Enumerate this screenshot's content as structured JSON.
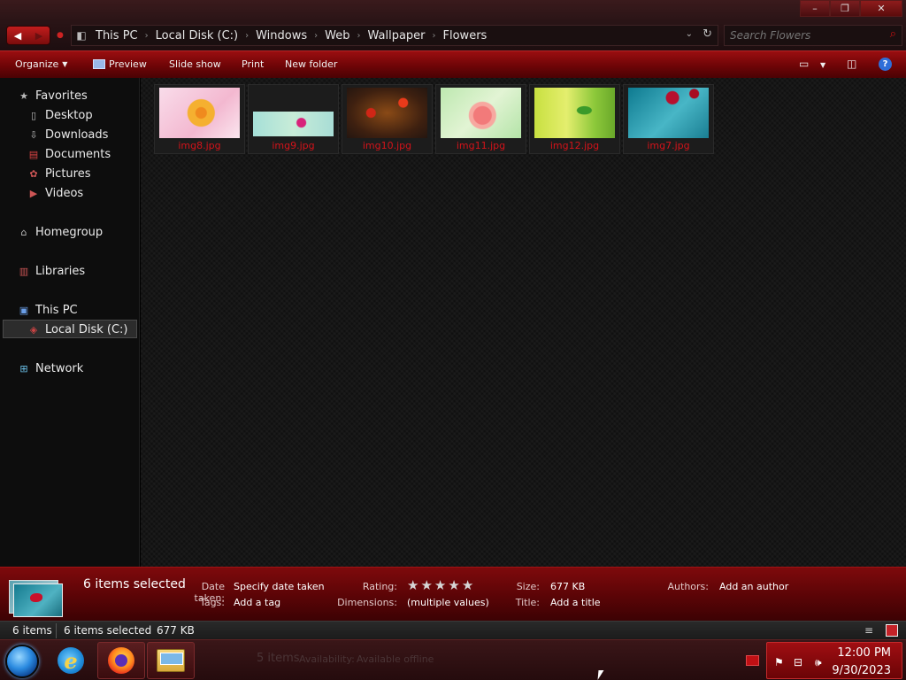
{
  "window": {
    "caption_minimize": "–",
    "caption_maximize": "❐",
    "caption_close": "✕"
  },
  "address_bar": {
    "breadcrumbs": [
      "This PC",
      "Local Disk (C:)",
      "Windows",
      "Web",
      "Wallpaper",
      "Flowers"
    ],
    "search_placeholder": "Search Flowers"
  },
  "toolbar": {
    "organize": "Organize",
    "preview": "Preview",
    "slideshow": "Slide show",
    "print": "Print",
    "new_folder": "New folder"
  },
  "nav_pane": {
    "favorites": "Favorites",
    "favorite_items": [
      "Desktop",
      "Downloads",
      "Documents",
      "Pictures",
      "Videos"
    ],
    "homegroup": "Homegroup",
    "libraries": "Libraries",
    "this_pc": "This PC",
    "local_disk": "Local Disk (C:)",
    "network": "Network"
  },
  "files": [
    {
      "name": "img8.jpg"
    },
    {
      "name": "img9.jpg"
    },
    {
      "name": "img10.jpg"
    },
    {
      "name": "img11.jpg"
    },
    {
      "name": "img12.jpg"
    },
    {
      "name": "img7.jpg"
    }
  ],
  "details": {
    "selection": "6 items selected",
    "date_taken_label": "Date taken:",
    "date_taken_value": "Specify date taken",
    "tags_label": "Tags:",
    "tags_value": "Add a tag",
    "rating_label": "Rating:",
    "rating_stars": 0,
    "dimensions_label": "Dimensions:",
    "dimensions_value": "(multiple values)",
    "size_label": "Size:",
    "size_value": "677 KB",
    "title_label": "Title:",
    "title_value": "Add a title",
    "authors_label": "Authors:",
    "authors_value": "Add an author"
  },
  "status_bar": {
    "item_count": "6 items",
    "selection": "6 items selected",
    "size": "677 KB"
  },
  "taskbar": {
    "ghost_big": "5 items",
    "ghost_availability_label": "Availability:",
    "ghost_availability_value": "Available offline",
    "clock_time": "12:00 PM",
    "clock_date": "9/30/2023"
  },
  "colors": {
    "accent": "#8a0a0c",
    "file_label": "#d4131a",
    "content_bg": "#161616"
  }
}
